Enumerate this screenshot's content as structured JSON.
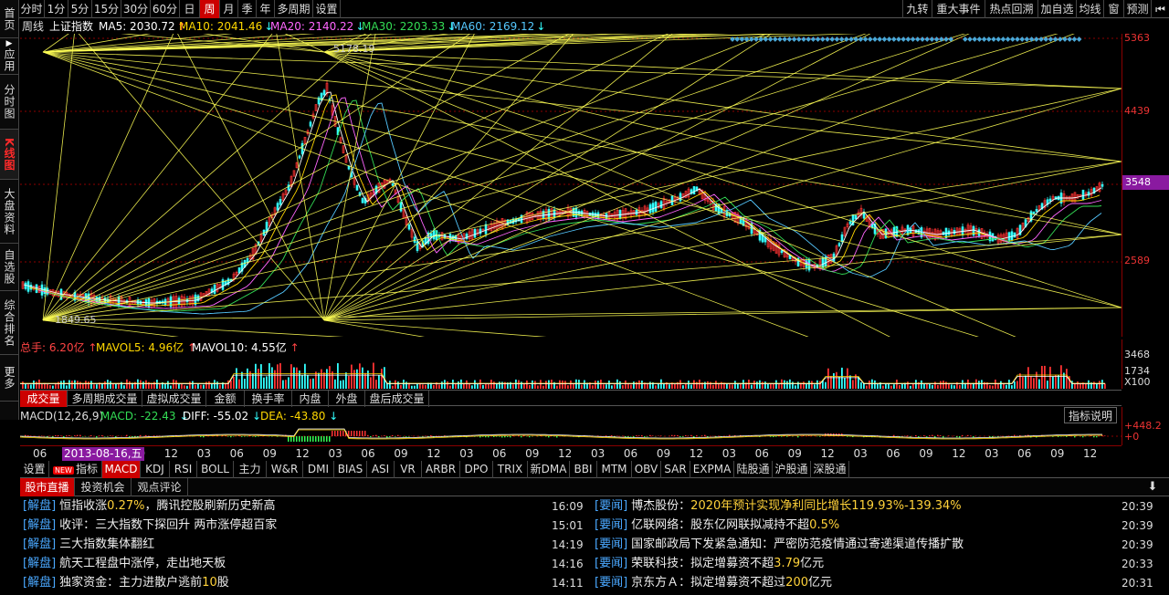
{
  "left_nav": [
    {
      "label": "首页",
      "active": false
    },
    {
      "label": "应用",
      "active": false,
      "arrow": true
    },
    {
      "label": "分时图",
      "active": false
    },
    {
      "label": "K线图",
      "active": true
    },
    {
      "label": "大盘资料",
      "active": false
    },
    {
      "label": "自选股",
      "active": false
    },
    {
      "label": "综合排名",
      "active": false
    },
    {
      "label": "更多",
      "active": false
    }
  ],
  "period_tabs": [
    {
      "label": "分时",
      "active": false
    },
    {
      "label": "1分",
      "active": false
    },
    {
      "label": "5分",
      "active": false
    },
    {
      "label": "15分",
      "active": false
    },
    {
      "label": "30分",
      "active": false
    },
    {
      "label": "60分",
      "active": false
    },
    {
      "label": "日",
      "active": false
    },
    {
      "label": "周",
      "active": true
    },
    {
      "label": "月",
      "active": false
    },
    {
      "label": "季",
      "active": false
    },
    {
      "label": "年",
      "active": false
    },
    {
      "label": "多周期",
      "active": false
    },
    {
      "label": "设置",
      "active": false
    }
  ],
  "right_tools": [
    "九转",
    "重大事件",
    "热点回溯",
    "加自选",
    "均线",
    "窗",
    "预测"
  ],
  "chart_header": {
    "period": "周线",
    "index_name": "上证指数",
    "ma5": {
      "label": "MA5: 2030.72",
      "arrow": "↑",
      "color": "#ffffff"
    },
    "ma10": {
      "label": "MA10: 2041.46",
      "arrow": "↓",
      "color": "#ffd800"
    },
    "ma20": {
      "label": "MA20: 2140.22",
      "arrow": "↓",
      "color": "#ff66ff"
    },
    "ma30": {
      "label": "MA30: 2203.33",
      "arrow": "↓",
      "color": "#33dd55"
    },
    "ma60": {
      "label": "MA60: 2169.12",
      "arrow": "↓",
      "color": "#55c8ff"
    }
  },
  "price_axis": [
    "5363",
    "4439",
    "3548",
    "2589"
  ],
  "current_price_tag": "3548",
  "annotations": {
    "high": "5178.19",
    "low": "1849.65"
  },
  "volume_header": {
    "total": "总手: 6.20亿",
    "mavol5": "MAVOL5: 4.96亿",
    "mavol10": "MAVOL10: 4.55亿"
  },
  "volume_axis": [
    "3468",
    "1734",
    "X100"
  ],
  "volume_tabs": [
    {
      "label": "成交量",
      "active": true
    },
    {
      "label": "多周期成交量",
      "active": false
    },
    {
      "label": "虚拟成交量",
      "active": false
    },
    {
      "label": "金额",
      "active": false
    },
    {
      "label": "换手率",
      "active": false
    },
    {
      "label": "内盘",
      "active": false
    },
    {
      "label": "外盘",
      "active": false
    },
    {
      "label": "盘后成交量",
      "active": false
    }
  ],
  "macd_header": {
    "params": "MACD(12,26,9)",
    "macd": "MACD: -22.43",
    "diff": "DIFF: -55.02",
    "dea": "DEA: -43.80",
    "explain_button": "指标说明"
  },
  "macd_axis": [
    "+448.2",
    "+0"
  ],
  "time_axis": {
    "labels": [
      "06",
      "03",
      "06",
      "09",
      "12",
      "03",
      "06",
      "09",
      "12",
      "03",
      "06",
      "09",
      "12",
      "03",
      "06",
      "09",
      "12",
      "03",
      "06",
      "09",
      "12",
      "03",
      "06",
      "09",
      "12",
      "03",
      "06",
      "09",
      "12",
      "03",
      "06",
      "09",
      "12"
    ],
    "cursor_date": "2013-08-16,五"
  },
  "indicator_tabs": [
    {
      "label": "设置",
      "active": false
    },
    {
      "label": "指标广场",
      "active": false,
      "badge": "NEW"
    },
    {
      "label": "MACD",
      "active": true
    },
    {
      "label": "KDJ",
      "active": false
    },
    {
      "label": "RSI",
      "active": false
    },
    {
      "label": "BOLL",
      "active": false
    },
    {
      "label": "主力",
      "active": false
    },
    {
      "label": "W&R",
      "active": false
    },
    {
      "label": "DMI",
      "active": false
    },
    {
      "label": "BIAS",
      "active": false
    },
    {
      "label": "ASI",
      "active": false
    },
    {
      "label": "VR",
      "active": false
    },
    {
      "label": "ARBR",
      "active": false
    },
    {
      "label": "DPO",
      "active": false
    },
    {
      "label": "TRIX",
      "active": false
    },
    {
      "label": "新DMA",
      "active": false
    },
    {
      "label": "BBI",
      "active": false
    },
    {
      "label": "MTM",
      "active": false
    },
    {
      "label": "OBV",
      "active": false
    },
    {
      "label": "SAR",
      "active": false
    },
    {
      "label": "EXPMA",
      "active": false
    },
    {
      "label": "陆股通",
      "active": false
    },
    {
      "label": "沪股通",
      "active": false
    },
    {
      "label": "深股通",
      "active": false
    }
  ],
  "news_tabs": [
    {
      "label": "股市直播",
      "active": true
    },
    {
      "label": "投资机会",
      "active": false
    },
    {
      "label": "观点评论",
      "active": false
    }
  ],
  "news_left": [
    {
      "tag": "[解盘]",
      "text": "恒指收涨",
      "hl": "0.27%",
      "text2": "，腾讯控股刷新历史新高",
      "time": "16:09"
    },
    {
      "tag": "[解盘]",
      "text": "收评：三大指数下探回升 两市涨停超百家",
      "hl": "",
      "text2": "",
      "time": "15:01"
    },
    {
      "tag": "[解盘]",
      "text": "三大指数集体翻红",
      "hl": "",
      "text2": "",
      "time": "14:19"
    },
    {
      "tag": "[解盘]",
      "text": "航天工程盘中涨停，走出地天板",
      "hl": "",
      "text2": "",
      "time": "14:16"
    },
    {
      "tag": "[解盘]",
      "text": "独家资金：主力进散户逃前",
      "hl": "10",
      "text2": "股",
      "time": "14:11"
    }
  ],
  "news_right": [
    {
      "tag": "[要闻]",
      "text": "博杰股份：",
      "hl": "2020年预计实现净利同比增长119.93%-139.34%",
      "text2": "",
      "time": "20:39"
    },
    {
      "tag": "[要闻]",
      "text": "亿联网络：股东亿网联拟减持不超",
      "hl": "0.5%",
      "text2": "",
      "time": "20:39"
    },
    {
      "tag": "[要闻]",
      "text": "国家邮政局下发紧急通知：严密防范疫情通过寄递渠道传播扩散",
      "hl": "",
      "text2": "",
      "time": "20:39"
    },
    {
      "tag": "[要闻]",
      "text": "荣联科技：拟定增募资不超",
      "hl": "3.79",
      "text2": "亿元",
      "time": "20:33"
    },
    {
      "tag": "[要闻]",
      "text": "京东方Ａ：拟定增募资不超过",
      "hl": "200",
      "text2": "亿元",
      "time": "20:31"
    }
  ],
  "colors": {
    "up": "#ff3333",
    "down": "#33ffff",
    "grid": "#8b0000",
    "gann": "#ffff55"
  }
}
